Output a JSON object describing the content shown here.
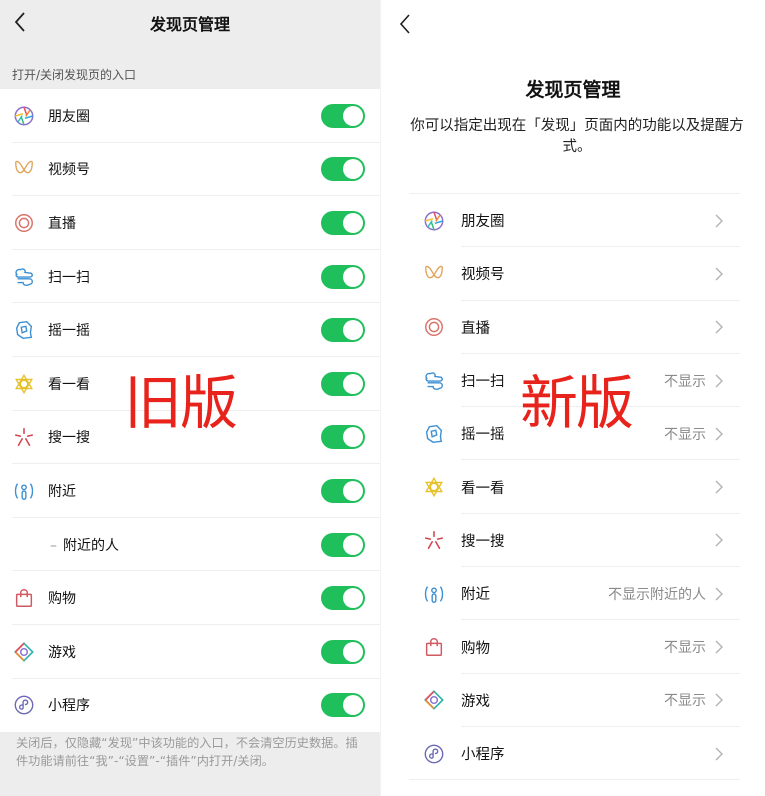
{
  "old_version": {
    "title": "发现页管理",
    "section_hint": "打开/关闭发现页的入口",
    "items": [
      {
        "icon": "moments-icon",
        "label": "朋友圈",
        "enabled": true
      },
      {
        "icon": "channels-icon",
        "label": "视频号",
        "enabled": true
      },
      {
        "icon": "live-icon",
        "label": "直播",
        "enabled": true
      },
      {
        "icon": "scan-icon",
        "label": "扫一扫",
        "enabled": true
      },
      {
        "icon": "shake-icon",
        "label": "摇一摇",
        "enabled": true
      },
      {
        "icon": "top-stories-icon",
        "label": "看一看",
        "enabled": true
      },
      {
        "icon": "search-icon",
        "label": "搜一搜",
        "enabled": true
      },
      {
        "icon": "nearby-icon",
        "label": "附近",
        "enabled": true
      },
      {
        "icon": "",
        "label": "附近的人",
        "enabled": true,
        "sub": true,
        "prefix": "–"
      },
      {
        "icon": "shopping-icon",
        "label": "购物",
        "enabled": true
      },
      {
        "icon": "games-icon",
        "label": "游戏",
        "enabled": true
      },
      {
        "icon": "mini-programs-icon",
        "label": "小程序",
        "enabled": true
      }
    ],
    "footer": "关闭后，仅隐藏“发现”中该功能的入口，不会清空历史数据。插件功能请前往“我”-“设置”-“插件”内打开/关闭。",
    "stamp": "旧版"
  },
  "new_version": {
    "title": "发现页管理",
    "description": "你可以指定出现在「发现」页面内的功能以及提醒方式。",
    "items": [
      {
        "icon": "moments-icon",
        "label": "朋友圈",
        "value": ""
      },
      {
        "icon": "channels-icon",
        "label": "视频号",
        "value": ""
      },
      {
        "icon": "live-icon",
        "label": "直播",
        "value": ""
      },
      {
        "icon": "scan-icon",
        "label": "扫一扫",
        "value": "不显示"
      },
      {
        "icon": "shake-icon",
        "label": "摇一摇",
        "value": "不显示"
      },
      {
        "icon": "top-stories-icon",
        "label": "看一看",
        "value": ""
      },
      {
        "icon": "search-icon",
        "label": "搜一搜",
        "value": ""
      },
      {
        "icon": "nearby-icon",
        "label": "附近",
        "value": "不显示附近的人"
      },
      {
        "icon": "shopping-icon",
        "label": "购物",
        "value": "不显示"
      },
      {
        "icon": "games-icon",
        "label": "游戏",
        "value": "不显示"
      },
      {
        "icon": "mini-programs-icon",
        "label": "小程序",
        "value": ""
      }
    ],
    "stamp": "新版"
  },
  "colors": {
    "toggle_on": "#1fc05b",
    "stamp_red": "#e8231c",
    "old_bg": "#ededed"
  }
}
